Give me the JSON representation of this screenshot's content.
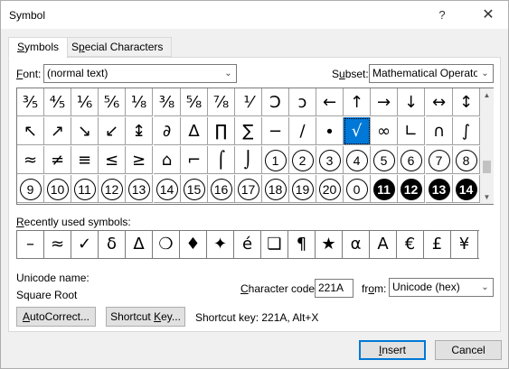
{
  "window": {
    "title": "Symbol",
    "help": "?",
    "close": "✕"
  },
  "tabs": [
    {
      "label": "Symbols",
      "hotkey_prefix": "",
      "hotkey": "S",
      "rest": "ymbols"
    },
    {
      "label": "Special Characters",
      "hotkey_prefix": "",
      "hotkey": "P",
      "rest": ""
    }
  ],
  "font": {
    "label_hot": "F",
    "label_rest": "ont:",
    "value": "(normal text)"
  },
  "subset": {
    "label_hot": "u",
    "label_pre": "S",
    "label_rest": "bset:",
    "value": "Mathematical Operato"
  },
  "grid": [
    [
      "⅗",
      "⅘",
      "⅙",
      "⅚",
      "⅛",
      "⅜",
      "⅝",
      "⅞",
      "⅟",
      "Ↄ",
      "ↄ",
      "←",
      "↑",
      "→",
      "↓",
      "↔",
      "↕"
    ],
    [
      "↖",
      "↗",
      "↘",
      "↙",
      "↨",
      "∂",
      "∆",
      "∏",
      "∑",
      "−",
      "∕",
      "∙",
      "√",
      "∞",
      "∟",
      "∩",
      "∫"
    ],
    [
      "≈",
      "≠",
      "≡",
      "≤",
      "≥",
      "⌂",
      "⌐",
      "⌠",
      "⌡",
      "1",
      "2",
      "3",
      "4",
      "5",
      "6",
      "7",
      "8"
    ],
    [
      "9",
      "10",
      "11",
      "12",
      "13",
      "14",
      "15",
      "16",
      "17",
      "18",
      "19",
      "20",
      "0",
      "11",
      "12",
      "13",
      "14"
    ]
  ],
  "selected_symbol": "√",
  "recent_label": {
    "hot": "R",
    "rest": "ecently used symbols:"
  },
  "recent": [
    "–",
    "≈",
    "✓",
    "δ",
    "Δ",
    "❍",
    "♦",
    "✦",
    "é",
    "❏",
    "¶",
    "★",
    "α",
    "A",
    "€",
    "£",
    "¥"
  ],
  "unicode_name_label": "Unicode name:",
  "unicode_name_value": "Square Root",
  "char_code": {
    "label_hot": "C",
    "label_rest": "haracter code:",
    "value": "221A"
  },
  "from": {
    "label_pre": "fr",
    "label_hot": "o",
    "label_rest": "m:",
    "value": "Unicode (hex)"
  },
  "autocorrect_button": {
    "hot": "A",
    "rest": "utoCorrect..."
  },
  "shortcut_key_button": {
    "pre": "Shortcut ",
    "hot": "K",
    "rest": "ey..."
  },
  "shortcut_key_text": "Shortcut key: 221A, Alt+X",
  "insert_button": {
    "hot": "I",
    "rest": "nsert"
  },
  "cancel_button": "Cancel"
}
